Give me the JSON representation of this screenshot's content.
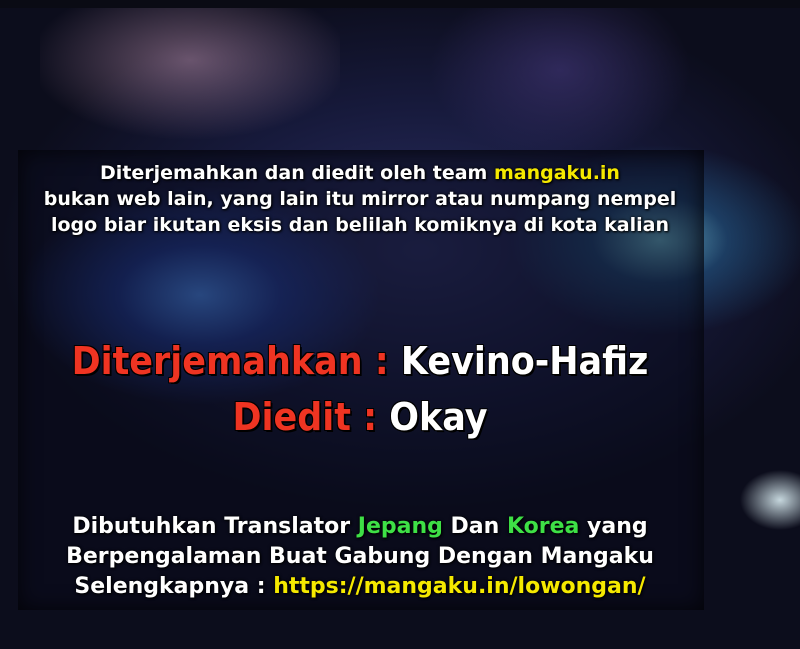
{
  "credit": {
    "line1_prefix": "Diterjemahkan dan diedit  oleh team ",
    "line1_site": "mangaku.in",
    "line2": "bukan web lain, yang lain itu  mirror atau  numpang nempel",
    "line3": "logo biar ikutan eksis  dan belilah komiknya di kota kalian"
  },
  "roles": {
    "translator_label": "Diterjemahkan",
    "translator_separator": " : ",
    "translator_name": "Kevino-Hafiz",
    "editor_label": "Diedit",
    "editor_separator": " : ",
    "editor_name": "Okay"
  },
  "recruit": {
    "line1_prefix": "Dibutuhkan Translator ",
    "language_1": "Jepang",
    "line1_middle": " Dan ",
    "language_2": "Korea",
    "line1_suffix": " yang",
    "line2": "Berpengalaman Buat Gabung Dengan Mangaku",
    "line3_prefix": "Selengkapnya : ",
    "link": "https://mangaku.in/lowongan/"
  },
  "colors": {
    "site_highlight": "#f5e900",
    "label_red": "#ef3422",
    "language_green": "#3ee046",
    "link_yellow": "#f5e900",
    "text_white": "#ffffff"
  }
}
